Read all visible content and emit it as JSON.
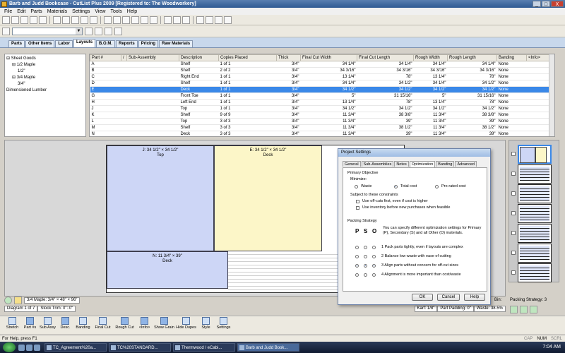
{
  "window": {
    "title": "Barb and Judd Bookcase - CutList Plus 2009 [Registered to: The Woodworkery]",
    "controls": [
      "_",
      "□",
      "X"
    ]
  },
  "menu": [
    "File",
    "Edit",
    "Parts",
    "Materials",
    "Settings",
    "View",
    "Tools",
    "Help"
  ],
  "tabs": [
    "Parts",
    "Other Items",
    "Labor",
    "Layouts",
    "B.O.M.",
    "Reports",
    "Pricing",
    "Raw Materials"
  ],
  "active_tab": "Layouts",
  "tree": [
    {
      "label": "Sheet Goods",
      "indent": 0,
      "prefix": "⊟"
    },
    {
      "label": "1/2 Maple",
      "indent": 1,
      "prefix": "⊟"
    },
    {
      "label": "1/2\"",
      "indent": 2,
      "prefix": ""
    },
    {
      "label": "3/4 Maple",
      "indent": 1,
      "prefix": "⊟"
    },
    {
      "label": "3/4\"",
      "indent": 2,
      "prefix": ""
    },
    {
      "label": "Dimensioned Lumber",
      "indent": 0,
      "prefix": ""
    }
  ],
  "grid": {
    "columns": [
      "Part #",
      "/",
      "Sub-Assembly",
      "Description",
      "Copies Placed",
      "Thick",
      "Final Cut Width",
      "Final Cut Length",
      "Rough Width",
      "Rough Length",
      "Banding",
      "<Info>"
    ],
    "rows": [
      {
        "part": "A",
        "sub": "",
        "desc": "Shelf",
        "copies": "1 of 1",
        "thick": "3/4\"",
        "fcw": "34 1/4\"",
        "fcl": "34 1/4\"",
        "rw": "34 1/4\"",
        "rl": "34 1/4\"",
        "band": "None",
        "info": ""
      },
      {
        "part": "B",
        "sub": "",
        "desc": "Shelf",
        "copies": "2 of 2",
        "thick": "3/4\"",
        "fcw": "34 3/16\"",
        "fcl": "34 3/16\"",
        "rw": "34 3/16\"",
        "rl": "34 3/16\"",
        "band": "None",
        "info": ""
      },
      {
        "part": "C",
        "sub": "",
        "desc": "Right End",
        "copies": "1 of 1",
        "thick": "3/4\"",
        "fcw": "13 1/4\"",
        "fcl": "78\"",
        "rw": "13 1/4\"",
        "rl": "78\"",
        "band": "None",
        "info": ""
      },
      {
        "part": "D",
        "sub": "",
        "desc": "Shelf",
        "copies": "1 of 1",
        "thick": "3/4\"",
        "fcw": "34 1/4\"",
        "fcl": "34 1/2\"",
        "rw": "34 1/4\"",
        "rl": "34 1/2\"",
        "band": "None",
        "info": ""
      },
      {
        "part": "E",
        "sub": "",
        "desc": "Deck",
        "copies": "1 of 1",
        "thick": "3/4\"",
        "fcw": "34 1/2\"",
        "fcl": "34 1/2\"",
        "rw": "34 1/2\"",
        "rl": "34 1/2\"",
        "band": "None",
        "info": ""
      },
      {
        "part": "G",
        "sub": "",
        "desc": "Front Toe",
        "copies": "1 of 1",
        "thick": "3/4\"",
        "fcw": "5\"",
        "fcl": "31 15/16\"",
        "rw": "5\"",
        "rl": "31 15/16\"",
        "band": "None",
        "info": ""
      },
      {
        "part": "H",
        "sub": "",
        "desc": "Left End",
        "copies": "1 of 1",
        "thick": "3/4\"",
        "fcw": "13 1/4\"",
        "fcl": "78\"",
        "rw": "13 1/4\"",
        "rl": "78\"",
        "band": "None",
        "info": ""
      },
      {
        "part": "J",
        "sub": "",
        "desc": "Top",
        "copies": "1 of 1",
        "thick": "3/4\"",
        "fcw": "34 1/2\"",
        "fcl": "34 1/2\"",
        "rw": "34 1/2\"",
        "rl": "34 1/2\"",
        "band": "None",
        "info": ""
      },
      {
        "part": "K",
        "sub": "",
        "desc": "Shelf",
        "copies": "9 of 9",
        "thick": "3/4\"",
        "fcw": "11 3/4\"",
        "fcl": "38 3/8\"",
        "rw": "11 3/4\"",
        "rl": "38 3/8\"",
        "band": "None",
        "info": ""
      },
      {
        "part": "L",
        "sub": "",
        "desc": "Top",
        "copies": "3 of 3",
        "thick": "3/4\"",
        "fcw": "11 3/4\"",
        "fcl": "39\"",
        "rw": "11 3/4\"",
        "rl": "39\"",
        "band": "None",
        "info": ""
      },
      {
        "part": "M",
        "sub": "",
        "desc": "Shelf",
        "copies": "3 of 3",
        "thick": "3/4\"",
        "fcw": "11 3/4\"",
        "fcl": "38 1/2\"",
        "rw": "11 3/4\"",
        "rl": "38 1/2\"",
        "band": "None",
        "info": ""
      },
      {
        "part": "N",
        "sub": "",
        "desc": "Deck",
        "copies": "3 of 3",
        "thick": "3/4\"",
        "fcw": "11 3/4\"",
        "fcl": "39\"",
        "rw": "11 3/4\"",
        "rl": "39\"",
        "band": "None",
        "info": ""
      }
    ],
    "selected_part": "E"
  },
  "sheet_pieces": {
    "j": {
      "dims": "J: 34 1/2\" × 34 1/2\"",
      "label": "Top"
    },
    "e": {
      "dims": "E: 34 1/2\" × 34 1/2\"",
      "label": "Deck"
    },
    "n": {
      "dims": "N: 11 3/4\" × 39\"",
      "label": "Deck"
    }
  },
  "dialog": {
    "title": "Project Settings",
    "tabs": [
      "General",
      "Sub-Assemblies",
      "Notes",
      "Optimization",
      "Banding",
      "Advanced"
    ],
    "active_tab": "Optimization",
    "primary_objective": "Primary Objective",
    "minimize": "Minimize:",
    "minimize_options": [
      "Waste",
      "Total cost",
      "Pro-rated cost"
    ],
    "minimize_selected": "Total cost",
    "constraints_label": "Subject to these constraints",
    "constraints": [
      "Use off-cuts first, even if cost is higher",
      "Use inventory before new purchases when feasible"
    ],
    "packing_label": "Packing Strategy",
    "pso": [
      "P",
      "S",
      "O"
    ],
    "packing_desc": "You can specify different optimization settings for Primary (P), Secondary (S) and all Other (O) materials.",
    "strategies": [
      "1  Pack parts tightly, even if layouts are complex",
      "2  Balance low waste with ease of cutting",
      "3  Align parts without concern for off-cut sizes",
      "4  Alignment is more important than cost/waste"
    ],
    "selected_strategy": 3,
    "buttons": {
      "ok": "OK",
      "cancel": "Cancel",
      "help": "Help"
    }
  },
  "status": {
    "material": "3/4 Maple: 3/4\" × 48\" × 96\"",
    "diagram": "Diagram 1 of 7",
    "stock_trim": "Stock Trim: 0\"::0\"",
    "kerf": "Karf: 1/8\"",
    "part_padding": "Part Padding: 0\"",
    "waste": "Waste: 38.5%",
    "bin": "Bin:",
    "packing_strategy": "Packing Strategy: 3"
  },
  "bottom_toolbar": [
    {
      "label": "Stretch",
      "on": false
    },
    {
      "label": "Part #s",
      "on": true
    },
    {
      "label": "Sub Assy",
      "on": false
    },
    {
      "label": "Desc.",
      "on": true
    },
    {
      "label": "Banding",
      "on": false
    },
    {
      "label": "Final Cut",
      "on": false
    },
    {
      "label": "Rough Cut",
      "on": true
    },
    {
      "label": "<Info>",
      "on": true
    },
    {
      "label": "Show Grain",
      "on": true
    },
    {
      "label": "Hide Dupes",
      "on": false
    },
    {
      "label": "Style",
      "on": false
    },
    {
      "label": "Settings",
      "on": false
    }
  ],
  "statusbar": {
    "help": "For Help, press F1",
    "caps": [
      "CAP",
      "NUM",
      "SCRL"
    ]
  },
  "taskbar": {
    "items": [
      "TC_Agreement%20a...",
      "TC%20STANDARD...",
      "Thermwood / eCabi...",
      "Barb and Judd Book..."
    ],
    "active": "Barb and Judd Book...",
    "clock": "7:04 AM"
  }
}
